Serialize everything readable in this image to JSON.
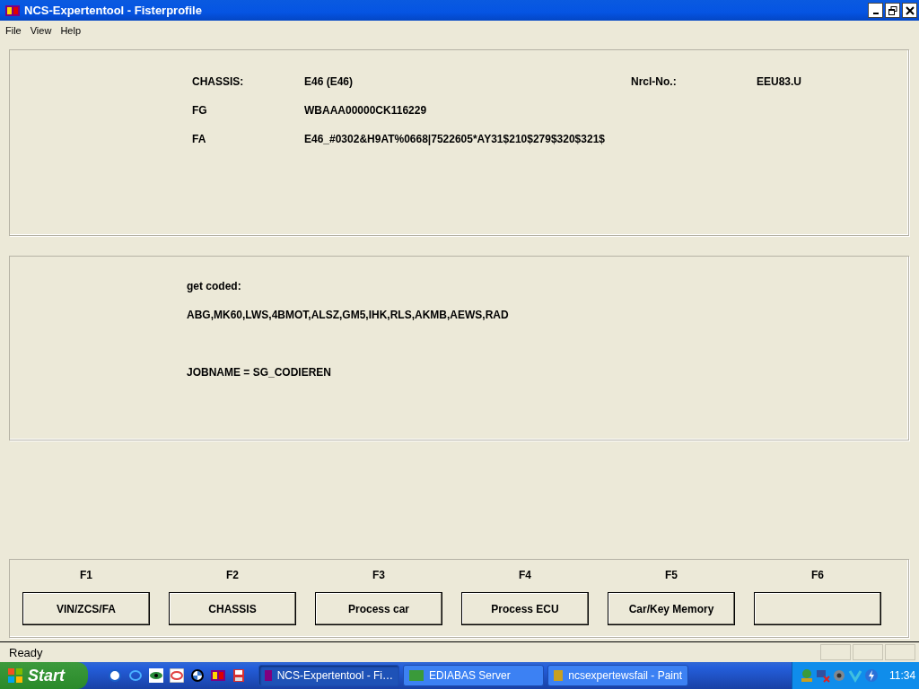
{
  "window": {
    "title": "NCS-Expertentool - Fisterprofile"
  },
  "menu": [
    "File",
    "View",
    "Help"
  ],
  "vehicle_panel": {
    "fields": [
      {
        "label": "CHASSIS:",
        "value": "E46 (E46)"
      },
      {
        "label": "FG",
        "value": "WBAAA00000CK116229"
      },
      {
        "label": "FA",
        "value": "E46_#0302&H9AT%0668|7522605*AY31$210$279$320$321$"
      }
    ],
    "nrcl": {
      "label": "Nrcl-No.:",
      "value": "EEU83.U"
    }
  },
  "job_panel": {
    "heading": "get coded:",
    "modules": "ABG,MK60,LWS,4BMOT,ALSZ,GM5,IHK,RLS,AKMB,AEWS,RAD",
    "jobname": "JOBNAME = SG_CODIEREN"
  },
  "function_keys": [
    {
      "key": "F1",
      "label": "VIN/ZCS/FA"
    },
    {
      "key": "F2",
      "label": "CHASSIS"
    },
    {
      "key": "F3",
      "label": "Process car"
    },
    {
      "key": "F4",
      "label": "Process ECU"
    },
    {
      "key": "F5",
      "label": "Car/Key Memory"
    },
    {
      "key": "F6"
    }
  ],
  "status_bar": {
    "text": "Ready"
  },
  "taskbar": {
    "start": "Start",
    "tasks": [
      {
        "label": "NCS-Expertentool - Fi…",
        "selected": true
      },
      {
        "label": "EDIABAS Server",
        "selected": false
      },
      {
        "label": "ncsexpertewsfail - Paint",
        "selected": false
      }
    ],
    "clock": "11:34"
  }
}
